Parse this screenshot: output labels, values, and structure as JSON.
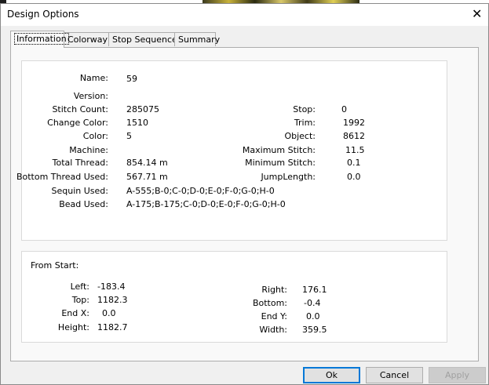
{
  "window": {
    "title": "Design Options",
    "close_icon": "close-icon"
  },
  "tabs": [
    {
      "label": "Information",
      "active": true
    },
    {
      "label": "Colorway",
      "active": false
    },
    {
      "label": "Stop Sequence",
      "active": false
    },
    {
      "label": "Summary",
      "active": false
    }
  ],
  "info": {
    "name": {
      "label": "Name:",
      "value": "59"
    },
    "version": {
      "label": "Version:",
      "value": ""
    },
    "stitch_count": {
      "label": "Stitch Count:",
      "value": "285075"
    },
    "change_color": {
      "label": "Change Color:",
      "value": "1510"
    },
    "color": {
      "label": "Color:",
      "value": "5"
    },
    "machine": {
      "label": "Machine:",
      "value": ""
    },
    "total_thread": {
      "label": "Total Thread:",
      "value": "854.14 m"
    },
    "bottom_thread": {
      "label": "Bottom Thread Used:",
      "value": "567.71 m"
    },
    "sequin": {
      "label": "Sequin Used:",
      "value": "A-555;B-0;C-0;D-0;E-0;F-0;G-0;H-0"
    },
    "bead": {
      "label": "Bead Used:",
      "value": "A-175;B-175;C-0;D-0;E-0;F-0;G-0;H-0"
    },
    "stop": {
      "label": "Stop:",
      "value": "0"
    },
    "trim": {
      "label": "Trim:",
      "value": "1992"
    },
    "object": {
      "label": "Object:",
      "value": "8612"
    },
    "max_stitch": {
      "label": "Maximum Stitch:",
      "value": "11.5"
    },
    "min_stitch": {
      "label": "Minimum Stitch:",
      "value": "0.1"
    },
    "jump_length": {
      "label": "JumpLength:",
      "value": "0.0"
    }
  },
  "from_start": {
    "heading": "From Start:",
    "left": {
      "label": "Left:",
      "value": "-183.4"
    },
    "top": {
      "label": "Top:",
      "value": "1182.3"
    },
    "end_x": {
      "label": "End X:",
      "value": "0.0"
    },
    "height": {
      "label": "Height:",
      "value": "1182.7"
    },
    "right": {
      "label": "Right:",
      "value": "176.1"
    },
    "bottom": {
      "label": "Bottom:",
      "value": "-0.4"
    },
    "end_y": {
      "label": "End Y:",
      "value": "0.0"
    },
    "width": {
      "label": "Width:",
      "value": "359.5"
    }
  },
  "buttons": {
    "ok": "Ok",
    "cancel": "Cancel",
    "apply": "Apply"
  }
}
